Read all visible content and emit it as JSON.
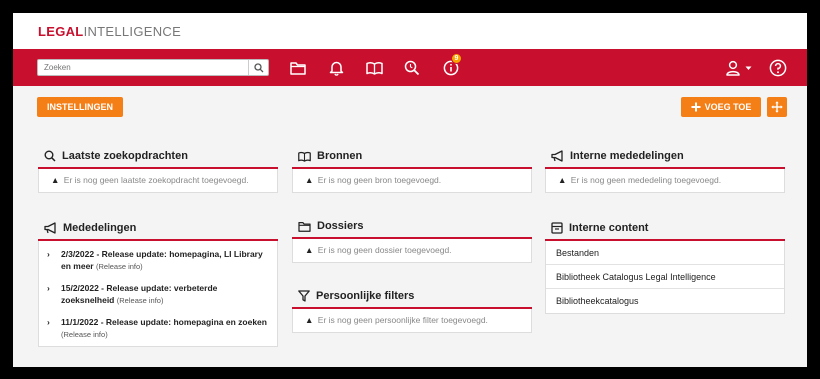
{
  "brand": {
    "part1": "LEGAL",
    "part2": "INTELLIGENCE"
  },
  "search": {
    "placeholder": "Zoeken"
  },
  "nav": {
    "notifications_badge": "9"
  },
  "toolbar": {
    "settings_label": "INSTELLINGEN",
    "add_label": "VOEG TOE"
  },
  "colors": {
    "brand_red": "#c8102e",
    "accent_orange": "#f57f17",
    "badge": "#f7a500"
  },
  "widgets": {
    "recent_searches": {
      "title": "Laatste zoekopdrachten",
      "empty": "Er is nog geen laatste zoekopdracht toegevoegd."
    },
    "news": {
      "title": "Mededelingen",
      "items": [
        {
          "title": "2/3/2022 - Release update: homepagina, LI Library en meer",
          "info": "(Release info)"
        },
        {
          "title": "15/2/2022 - Release update: verbeterde zoeksnelheid",
          "info": "(Release info)"
        },
        {
          "title": "11/1/2022 - Release update: homepagina en zoeken",
          "info": "(Release info)"
        }
      ]
    },
    "sources": {
      "title": "Bronnen",
      "empty": "Er is nog geen bron toegevoegd."
    },
    "dossiers": {
      "title": "Dossiers",
      "empty": "Er is nog geen dossier toegevoegd."
    },
    "personal_filters": {
      "title": "Persoonlijke filters",
      "empty": "Er is nog geen persoonlijke filter toegevoegd."
    },
    "internal_news": {
      "title": "Interne mededelingen",
      "empty": "Er is nog geen mededeling toegevoegd."
    },
    "internal_content": {
      "title": "Interne content",
      "items": [
        "Bestanden",
        "Bibliotheek Catalogus Legal Intelligence",
        "Bibliotheekcatalogus"
      ]
    }
  }
}
